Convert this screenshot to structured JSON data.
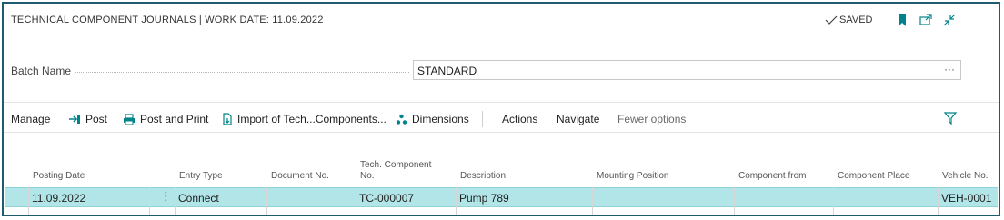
{
  "header": {
    "title": "TECHNICAL COMPONENT JOURNALS | WORK DATE: 11.09.2022",
    "saved_label": "SAVED",
    "icons": [
      "bookmark-icon",
      "open-new-window-icon",
      "collapse-icon"
    ]
  },
  "batch": {
    "label": "Batch Name",
    "value": "STANDARD",
    "ellipsis": "···"
  },
  "actions": {
    "manage": "Manage",
    "post": "Post",
    "post_and_print": "Post and Print",
    "import": "Import of Tech...Components...",
    "dimensions": "Dimensions",
    "actions": "Actions",
    "navigate": "Navigate",
    "fewer_options": "Fewer options"
  },
  "columns": {
    "posting_date": "Posting Date",
    "entry_type": "Entry Type",
    "document_no": "Document No.",
    "tech_component_no_1": "Tech. Component",
    "tech_component_no_2": "No.",
    "description": "Description",
    "mounting_position": "Mounting Position",
    "component_from": "Component from",
    "component_place": "Component Place",
    "vehicle_no": "Vehicle No."
  },
  "rows": [
    {
      "posting_date": "11.09.2022",
      "row_menu": "⋮",
      "entry_type": "Connect",
      "document_no": "",
      "tech_component_no": "TC-000007",
      "description": "Pump 789",
      "mounting_position": "",
      "component_from": "",
      "component_place": "",
      "vehicle_no": "VEH-0001"
    }
  ],
  "colors": {
    "accent": "#008489",
    "frame": "#1f5a6e",
    "row_highlight": "#b1e5e7"
  }
}
